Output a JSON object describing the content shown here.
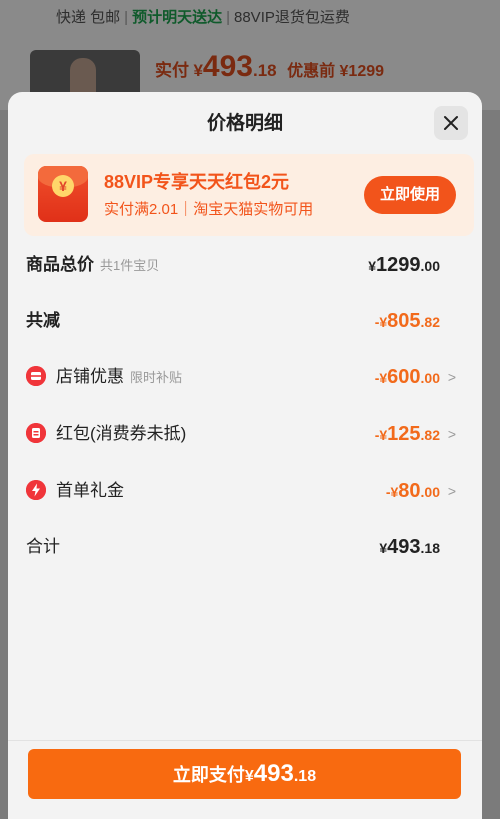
{
  "background": {
    "shipping": {
      "courier": "快递 包邮",
      "eta": "预计明天送达",
      "return": "88VIP退货包运费"
    },
    "price": {
      "label": "实付",
      "currency": "¥",
      "int": "493",
      "dec": ".18",
      "original": "优惠前 ¥1299"
    }
  },
  "sheet": {
    "title": "价格明细",
    "close_icon": "close-icon"
  },
  "promo": {
    "title": "88VIP专享天天红包2元",
    "subtitle": "实付满2.01｜淘宝天猫实物可用",
    "button": "立即使用",
    "icon": "red-envelope-icon",
    "icon_glyph": "¥"
  },
  "rows": [
    {
      "label": "商品总价",
      "note": "共1件宝贝",
      "prefix": "¥",
      "int": "1299",
      "dec": ".00"
    },
    {
      "label": "共减",
      "note": "",
      "prefix": "-¥",
      "int": "805",
      "dec": ".82"
    },
    {
      "label": "店铺优惠",
      "note": "限时补贴",
      "prefix": "-¥",
      "int": "600",
      "dec": ".00",
      "icon": "store-coupon-icon"
    },
    {
      "label": "红包(消费券未抵)",
      "note": "",
      "prefix": "-¥",
      "int": "125",
      "dec": ".82",
      "icon": "red-packet-icon"
    },
    {
      "label": "首单礼金",
      "note": "",
      "prefix": "-¥",
      "int": "80",
      "dec": ".00",
      "icon": "lightning-icon"
    },
    {
      "label": "合计",
      "note": "",
      "prefix": "¥",
      "int": "493",
      "dec": ".18"
    }
  ],
  "chevron": ">",
  "pay_button": {
    "label": "立即支付",
    "prefix": "¥",
    "int": "493",
    "dec": ".18"
  },
  "colors": {
    "accent": "#f86a10",
    "promo_text": "#f2541b",
    "discount": "#f26a1b",
    "icon_red": "#f0353a"
  }
}
